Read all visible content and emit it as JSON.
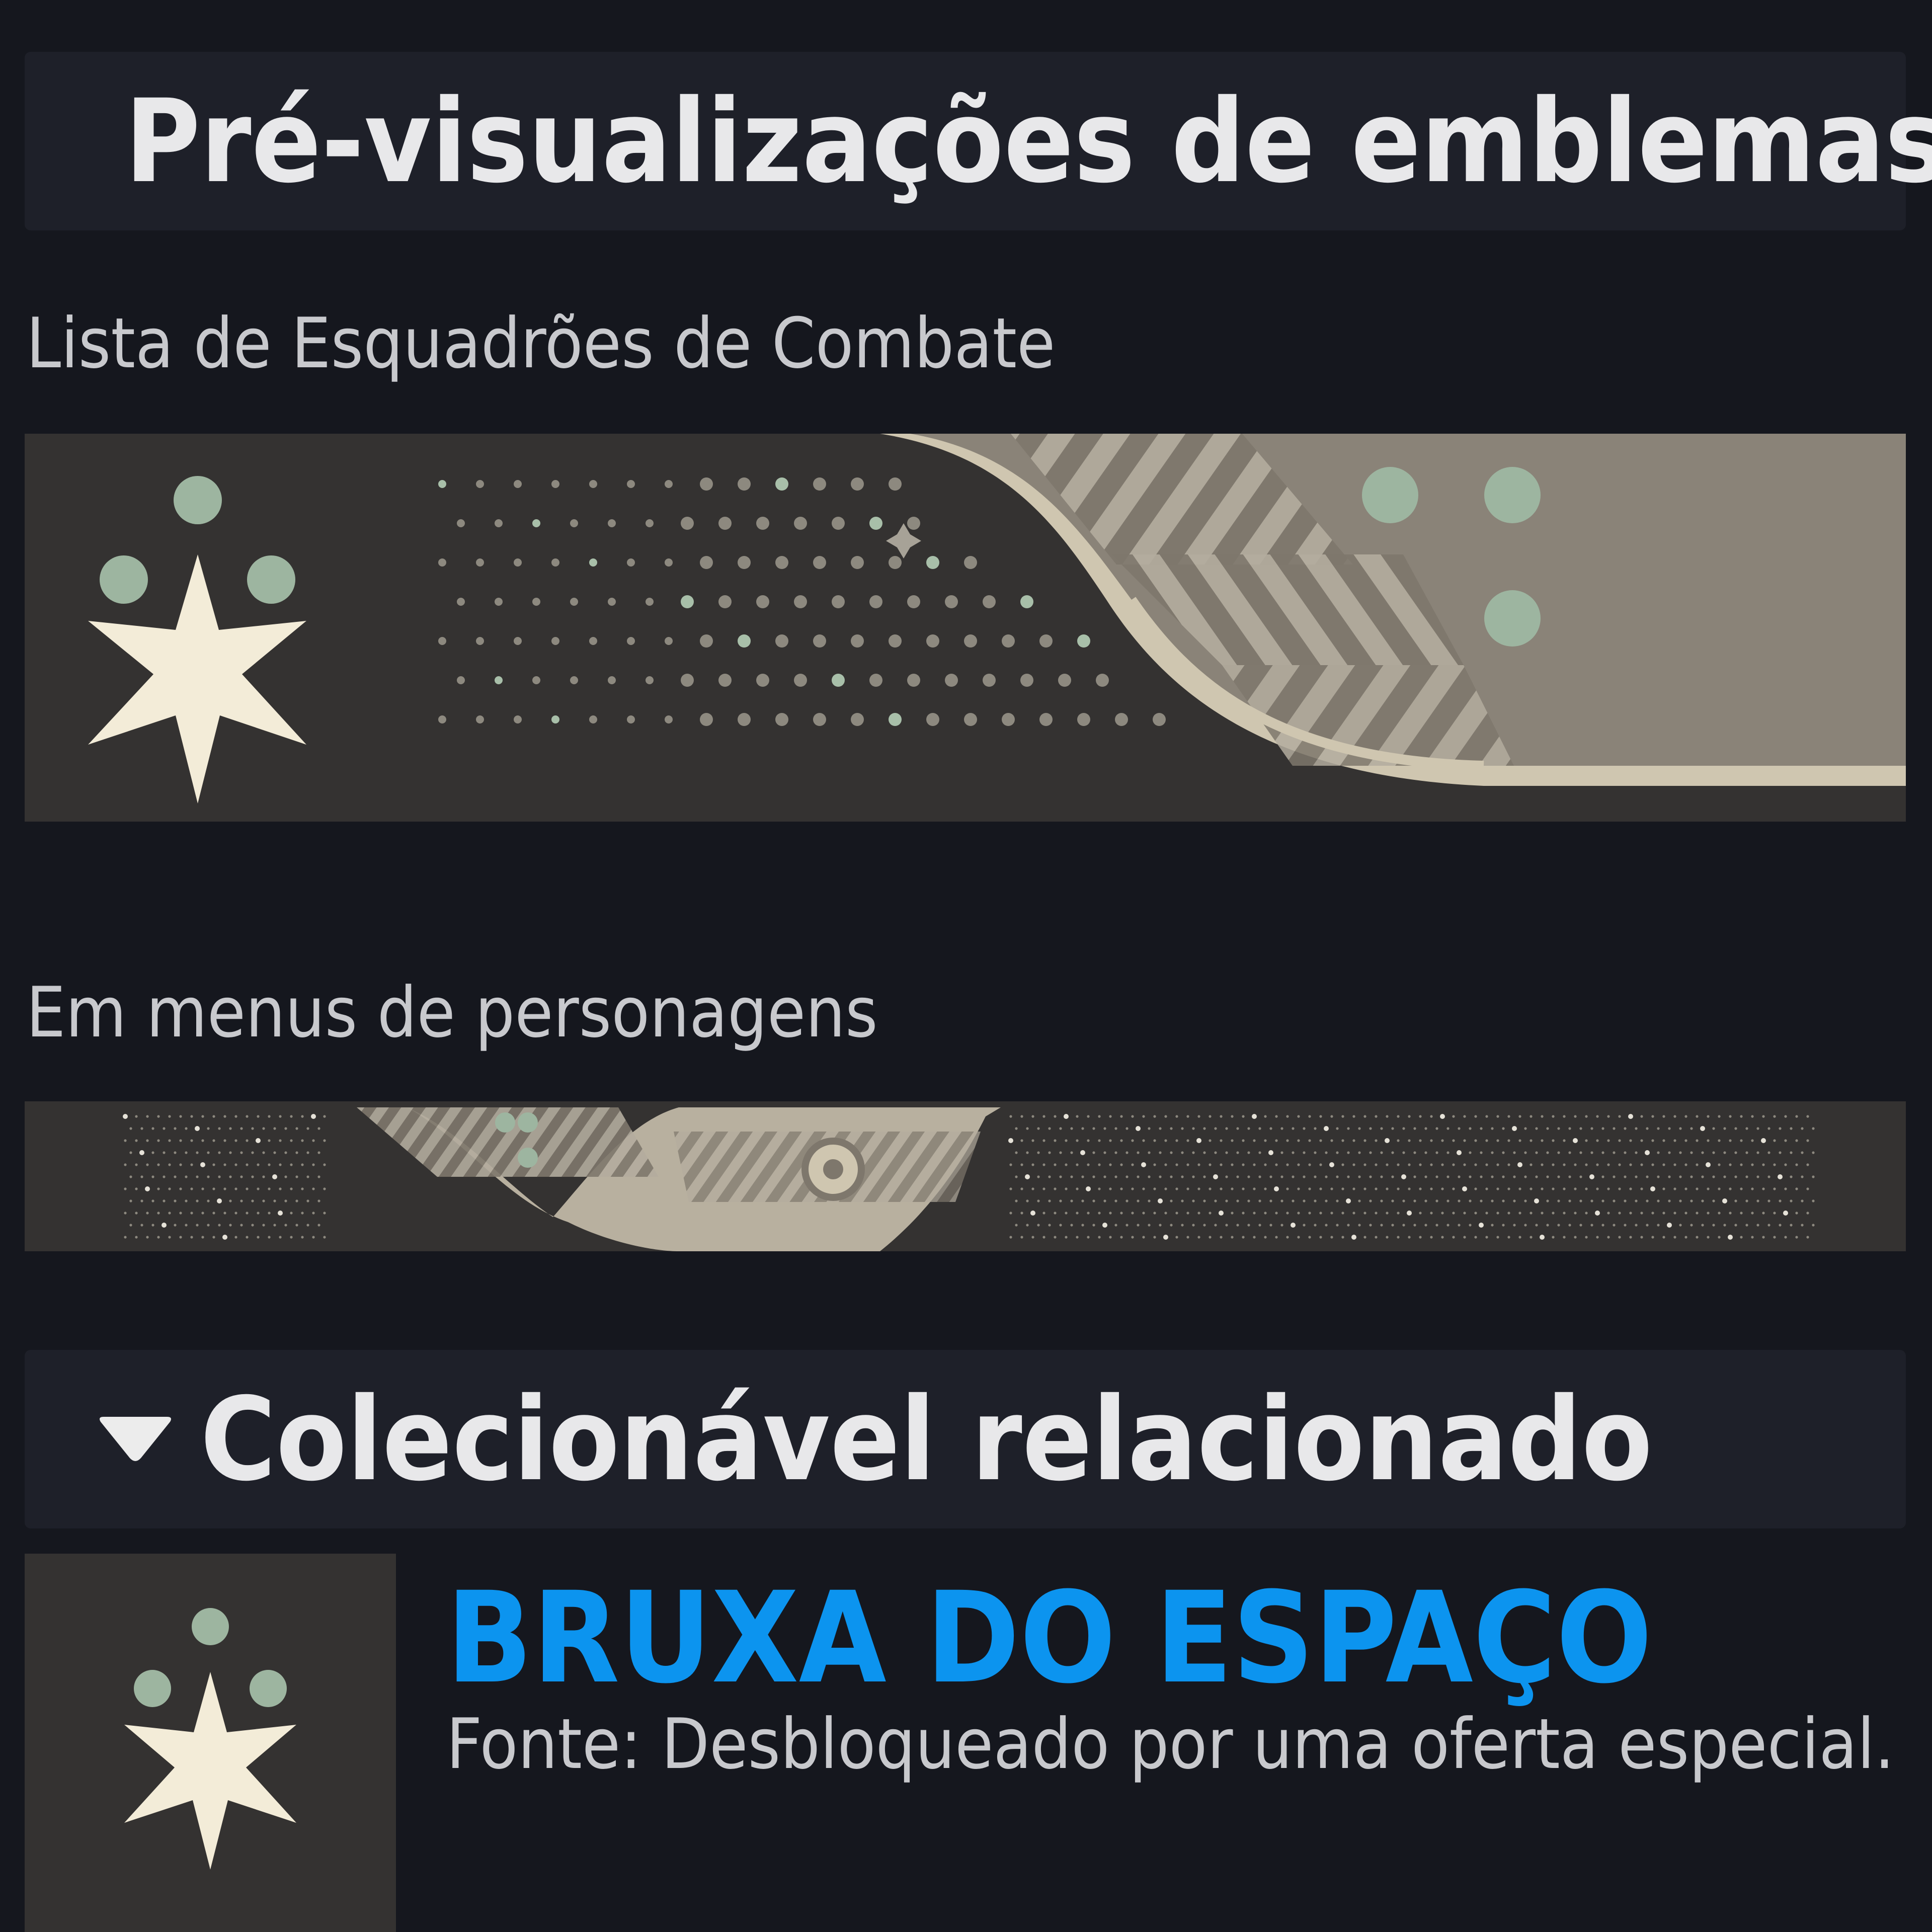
{
  "sections": [
    {
      "title": "Pré-visualizações de emblemas",
      "expanded": true
    },
    {
      "title": "Colecionável relacionado",
      "expanded": true
    }
  ],
  "emblem_previews": {
    "roster_label": "Lista de Esquadrões de Combate",
    "character_menu_label": "Em menus de personagens"
  },
  "collectible": {
    "name": "BRUXA DO ESPAÇO",
    "source": "Fonte: Desbloqueado por uma oferta especial."
  },
  "colors": {
    "background": "#15171e",
    "header_bg": "#1e2029",
    "accent_name": "#0c94ef",
    "emblem_dark": "#343231",
    "emblem_tan": "#8a8378",
    "emblem_cream": "#f3ecd8",
    "emblem_green": "#9db5a0"
  },
  "icons": [
    "caret-down-icon",
    "emblem-star-icon"
  ]
}
